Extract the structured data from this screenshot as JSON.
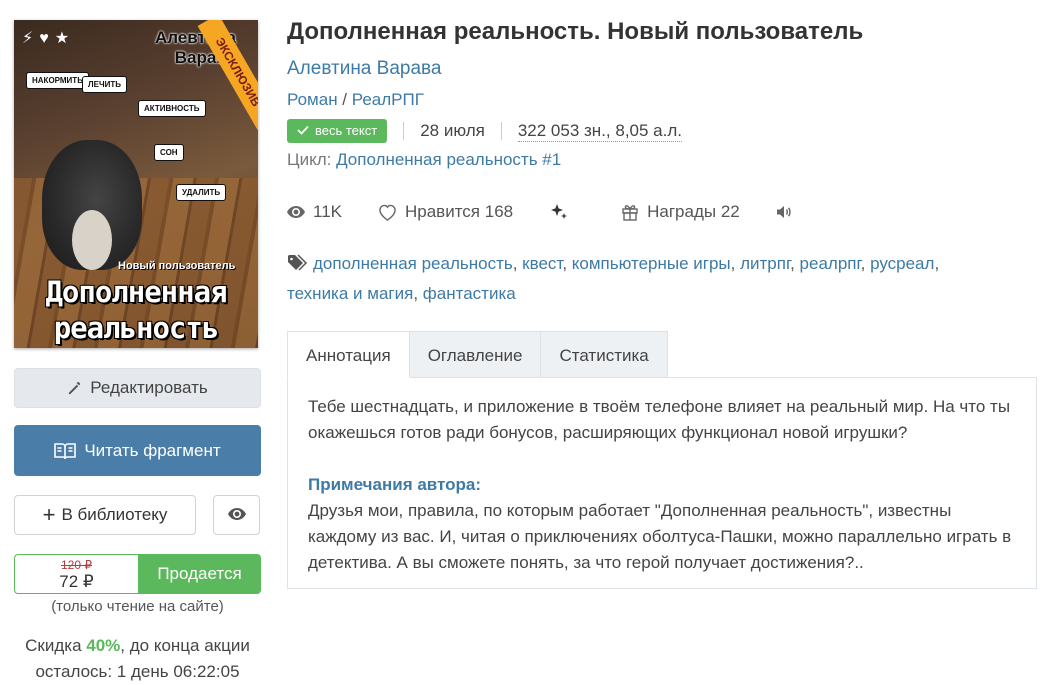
{
  "book": {
    "title": "Дополненная реальность. Новый пользователь",
    "author": "Алевтина Варава",
    "genre_1": "Роман",
    "genre_sep": " / ",
    "genre_2": "РеалРПГ",
    "badge": "весь текст",
    "date": "28 июля",
    "size": "322 053 зн., 8,05 а.л.",
    "cycle_label": "Цикл: ",
    "cycle_name": "Дополненная реальность #1"
  },
  "cover": {
    "ribbon": "ЭКСКЛЮЗИВ",
    "author_line1": "Алевтина",
    "author_line2": "Варава",
    "subtitle": "Новый пользователь",
    "title_line1": "Дополненная",
    "title_line2": "реальность",
    "bubbles": [
      "НАКОРМИТЬ",
      "ЛЕЧИТЬ",
      "АКТИВНОСТЬ",
      "СОН",
      "УДАЛИТЬ"
    ],
    "icons": [
      "bolt-icon",
      "heart-icon",
      "star-icon"
    ]
  },
  "stats": {
    "views": "11K",
    "likes_label": "Нравится",
    "likes_count": "168",
    "awards_label": "Награды",
    "awards_count": "22"
  },
  "tags": [
    "дополненная реальность",
    "квест",
    "компьютерные игры",
    "литрпг",
    "реалрпг",
    "русреал",
    "техника и магия",
    "фантастика"
  ],
  "tabs": [
    "Аннотация",
    "Оглавление",
    "Статистика"
  ],
  "annotation": {
    "text": "Тебе шестнадцать, и приложение в твоём телефоне влияет на реальный мир. На что ты окажешься готов ради бонусов, расширяющих функционал новой игрушки?",
    "notes_title": "Примечания автора:",
    "notes_text": "Друзья мои, правила, по которым работает \"Дополненная реальность\", известны каждому из вас. И, читая о приключениях оболтуса-Пашки, можно параллельно играть в детектива. А вы сможете понять, за что герой получает достижения?.."
  },
  "actions": {
    "edit": "Редактировать",
    "read": "Читать фрагмент",
    "library": "В библиотеку",
    "sale": "Продается"
  },
  "price": {
    "old": "120 ₽",
    "new": "72 ₽",
    "only_site": "(только чтение на сайте)",
    "discount_prefix": "Скидка ",
    "discount_pct": "40%",
    "discount_suffix": ", до конца акции",
    "remaining": "осталось: 1 день 06:22:05"
  },
  "colors": {
    "accent": "#3d7aa5",
    "green": "#5cb85c",
    "read_button": "#4a7ea8"
  }
}
